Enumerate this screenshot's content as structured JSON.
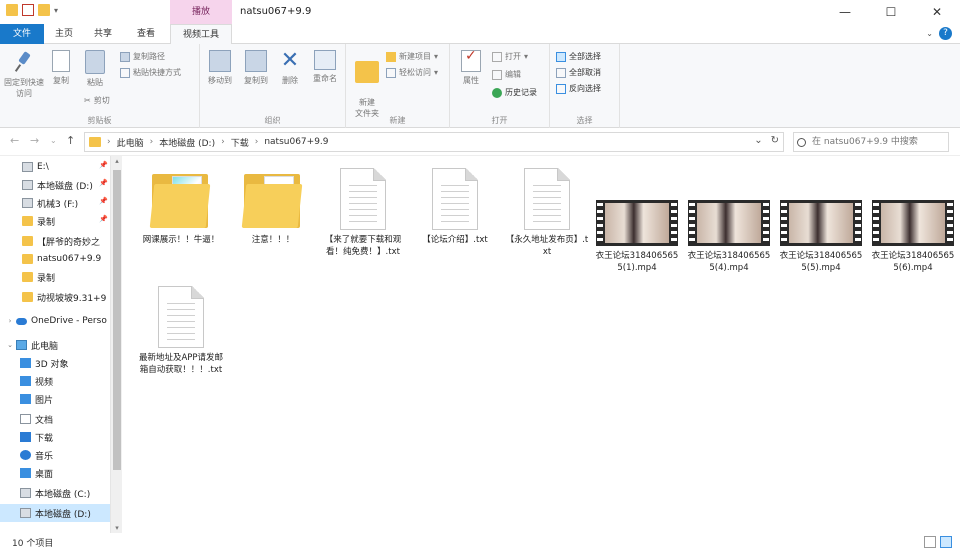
{
  "window": {
    "title": "natsu067+9.9",
    "context_tab_group": "播放",
    "controls": {
      "minimize": "—",
      "maximize": "☐",
      "close": "✕"
    }
  },
  "ribbon": {
    "tabs": [
      {
        "label": "文件"
      },
      {
        "label": "主页"
      },
      {
        "label": "共享"
      },
      {
        "label": "查看"
      },
      {
        "label": "视频工具"
      }
    ],
    "clipboard": {
      "group_label": "剪贴板",
      "pin_label": "固定到快速访问",
      "copy_label": "复制",
      "paste_label": "粘贴",
      "copy_path_label": "复制路径",
      "paste_shortcut_label": "粘贴快捷方式",
      "cut_label": "剪切"
    },
    "organize": {
      "group_label": "组织",
      "move_to_label": "移动到",
      "copy_to_label": "复制到",
      "delete_label": "删除",
      "rename_label": "重命名"
    },
    "new": {
      "group_label": "新建",
      "new_folder_label": "新建\n文件夹",
      "new_item_label": "新建项目",
      "easy_access_label": "轻松访问"
    },
    "open": {
      "group_label": "打开",
      "properties_label": "属性",
      "open_label": "打开",
      "edit_label": "编辑",
      "history_label": "历史记录"
    },
    "select": {
      "group_label": "选择",
      "select_all_label": "全部选择",
      "select_none_label": "全部取消",
      "invert_label": "反向选择"
    }
  },
  "address": {
    "crumbs": [
      "此电脑",
      "本地磁盘 (D:)",
      "下载",
      "natsu067+9.9"
    ],
    "search_placeholder": "在 natsu067+9.9 中搜索"
  },
  "nav": {
    "items": [
      {
        "label": "E:\\",
        "icon": "drive",
        "pinned": true
      },
      {
        "label": "本地磁盘 (D:)",
        "icon": "drive",
        "pinned": true
      },
      {
        "label": "机械3 (F:)",
        "icon": "drive",
        "pinned": true
      },
      {
        "label": "录制",
        "icon": "folder",
        "pinned": true
      },
      {
        "label": "【胖爷的奇妙之",
        "icon": "folder",
        "pinned": false
      },
      {
        "label": "natsu067+9.9",
        "icon": "folder",
        "pinned": false
      },
      {
        "label": "录制",
        "icon": "folder",
        "pinned": false
      },
      {
        "label": "动视坡坡9.31+9",
        "icon": "folder",
        "pinned": false
      },
      {
        "label": "OneDrive - Perso",
        "icon": "cloud",
        "pinned": false
      },
      {
        "label": "此电脑",
        "icon": "pc",
        "pinned": false
      },
      {
        "label": "3D 对象",
        "icon": "blue",
        "pinned": false
      },
      {
        "label": "视频",
        "icon": "blue",
        "pinned": false
      },
      {
        "label": "图片",
        "icon": "blue",
        "pinned": false
      },
      {
        "label": "文档",
        "icon": "doc",
        "pinned": false
      },
      {
        "label": "下载",
        "icon": "down",
        "pinned": false
      },
      {
        "label": "音乐",
        "icon": "music",
        "pinned": false
      },
      {
        "label": "桌面",
        "icon": "blue",
        "pinned": false
      },
      {
        "label": "本地磁盘 (C:)",
        "icon": "drive",
        "pinned": false
      },
      {
        "label": "本地磁盘 (D:)",
        "icon": "drive",
        "pinned": false,
        "selected": true
      }
    ]
  },
  "files": [
    {
      "name": "网课展示！！牛逼！",
      "type": "folder-colorful"
    },
    {
      "name": "注意！！！",
      "type": "folder"
    },
    {
      "name": "【来了就要下载和观看！纯免费！】.txt",
      "type": "txt"
    },
    {
      "name": "【论坛介绍】.txt",
      "type": "txt"
    },
    {
      "name": "【永久地址发布页】.txt",
      "type": "txt"
    },
    {
      "name": "衣王论坛3184065655(1).mp4",
      "type": "video"
    },
    {
      "name": "衣王论坛3184065655(4).mp4",
      "type": "video"
    },
    {
      "name": "衣王论坛3184065655(5).mp4",
      "type": "video"
    },
    {
      "name": "衣王论坛3184065655(6).mp4",
      "type": "video"
    },
    {
      "name": "最新地址及APP请发邮箱自动获取！！！.txt",
      "type": "txt"
    }
  ],
  "status": {
    "count": "10 个项目"
  }
}
